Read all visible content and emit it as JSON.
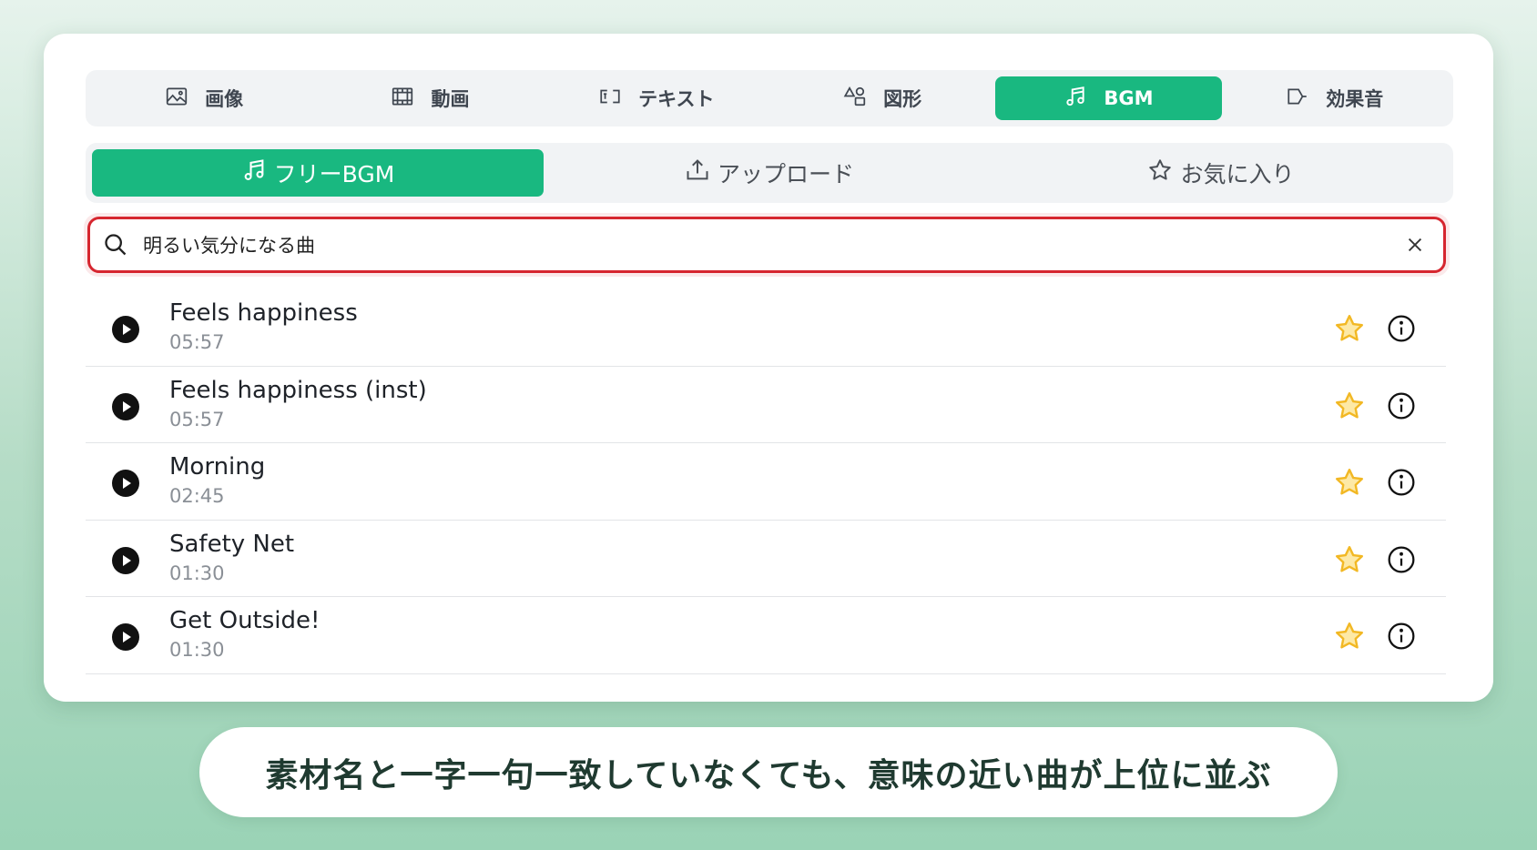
{
  "colors": {
    "accent": "#19b880",
    "search_border": "#d6262f",
    "star": "#f2b824",
    "star_fill": "#fde9a6"
  },
  "category_tabs": [
    {
      "icon": "image-icon",
      "label": "画像",
      "active": false
    },
    {
      "icon": "film-icon",
      "label": "動画",
      "active": false
    },
    {
      "icon": "text-box-icon",
      "label": "テキスト",
      "active": false
    },
    {
      "icon": "shapes-icon",
      "label": "図形",
      "active": false
    },
    {
      "icon": "music-note-icon",
      "label": "BGM",
      "active": true
    },
    {
      "icon": "sound-effect-icon",
      "label": "効果音",
      "active": false
    }
  ],
  "sub_tabs": [
    {
      "icon": "music-note-icon",
      "label": "フリーBGM",
      "active": true
    },
    {
      "icon": "upload-icon",
      "label": "アップロード",
      "active": false
    },
    {
      "icon": "star-icon",
      "label": "お気に入り",
      "active": false
    }
  ],
  "search": {
    "value": "明るい気分になる曲"
  },
  "tracks": [
    {
      "title": "Feels happiness",
      "duration": "05:57"
    },
    {
      "title": "Feels happiness (inst)",
      "duration": "05:57"
    },
    {
      "title": "Morning",
      "duration": "02:45"
    },
    {
      "title": "Safety Net",
      "duration": "01:30"
    },
    {
      "title": "Get Outside!",
      "duration": "01:30"
    }
  ],
  "caption": "素材名と一字一句一致していなくても、意味の近い曲が上位に並ぶ"
}
